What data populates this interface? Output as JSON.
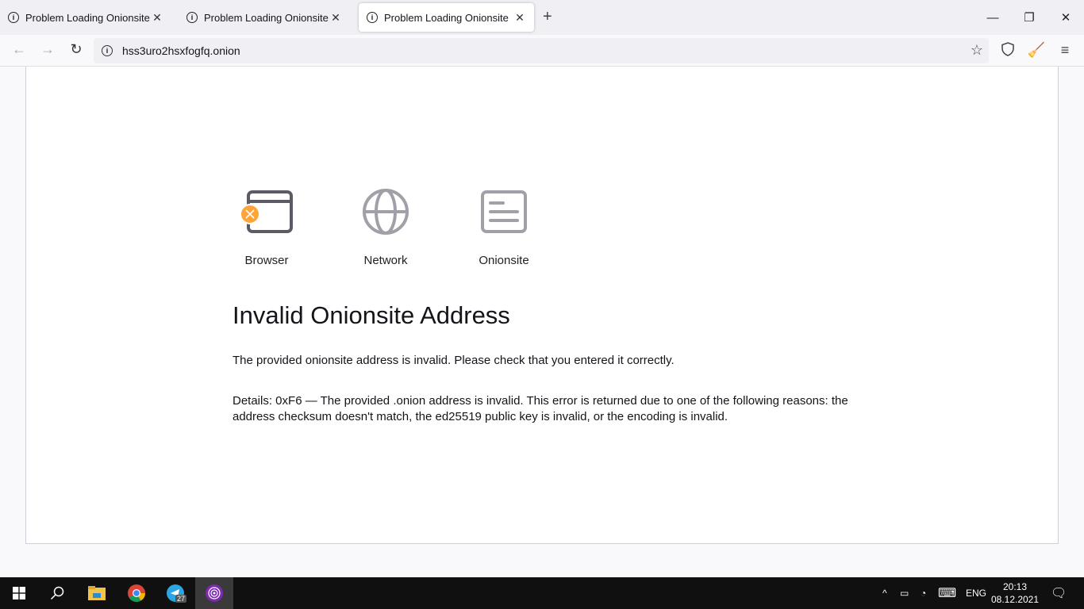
{
  "tabs": [
    {
      "title": "Problem Loading Onionsite",
      "active": false
    },
    {
      "title": "Problem Loading Onionsite",
      "active": false
    },
    {
      "title": "Problem Loading Onionsite",
      "active": true
    }
  ],
  "toolbar": {
    "url": "hss3uro2hsxfogfq.onion"
  },
  "steps": [
    {
      "label": "Browser",
      "icon": "browser-error-icon"
    },
    {
      "label": "Network",
      "icon": "globe-icon"
    },
    {
      "label": "Onionsite",
      "icon": "document-icon"
    }
  ],
  "error": {
    "title": "Invalid Onionsite Address",
    "message": "The provided onionsite address is invalid. Please check that you entered it correctly.",
    "details": "Details: 0xF6 — The provided .onion address is invalid. This error is returned due to one of the following reasons: the address checksum doesn't match, the ed25519 public key is invalid, or the encoding is invalid."
  },
  "taskbar": {
    "telegram_badge": "27",
    "language": "ENG",
    "time": "20:13",
    "date": "08.12.2021"
  },
  "colors": {
    "error_badge": "#ffa436",
    "tor_purple": "#7d2ab0"
  }
}
